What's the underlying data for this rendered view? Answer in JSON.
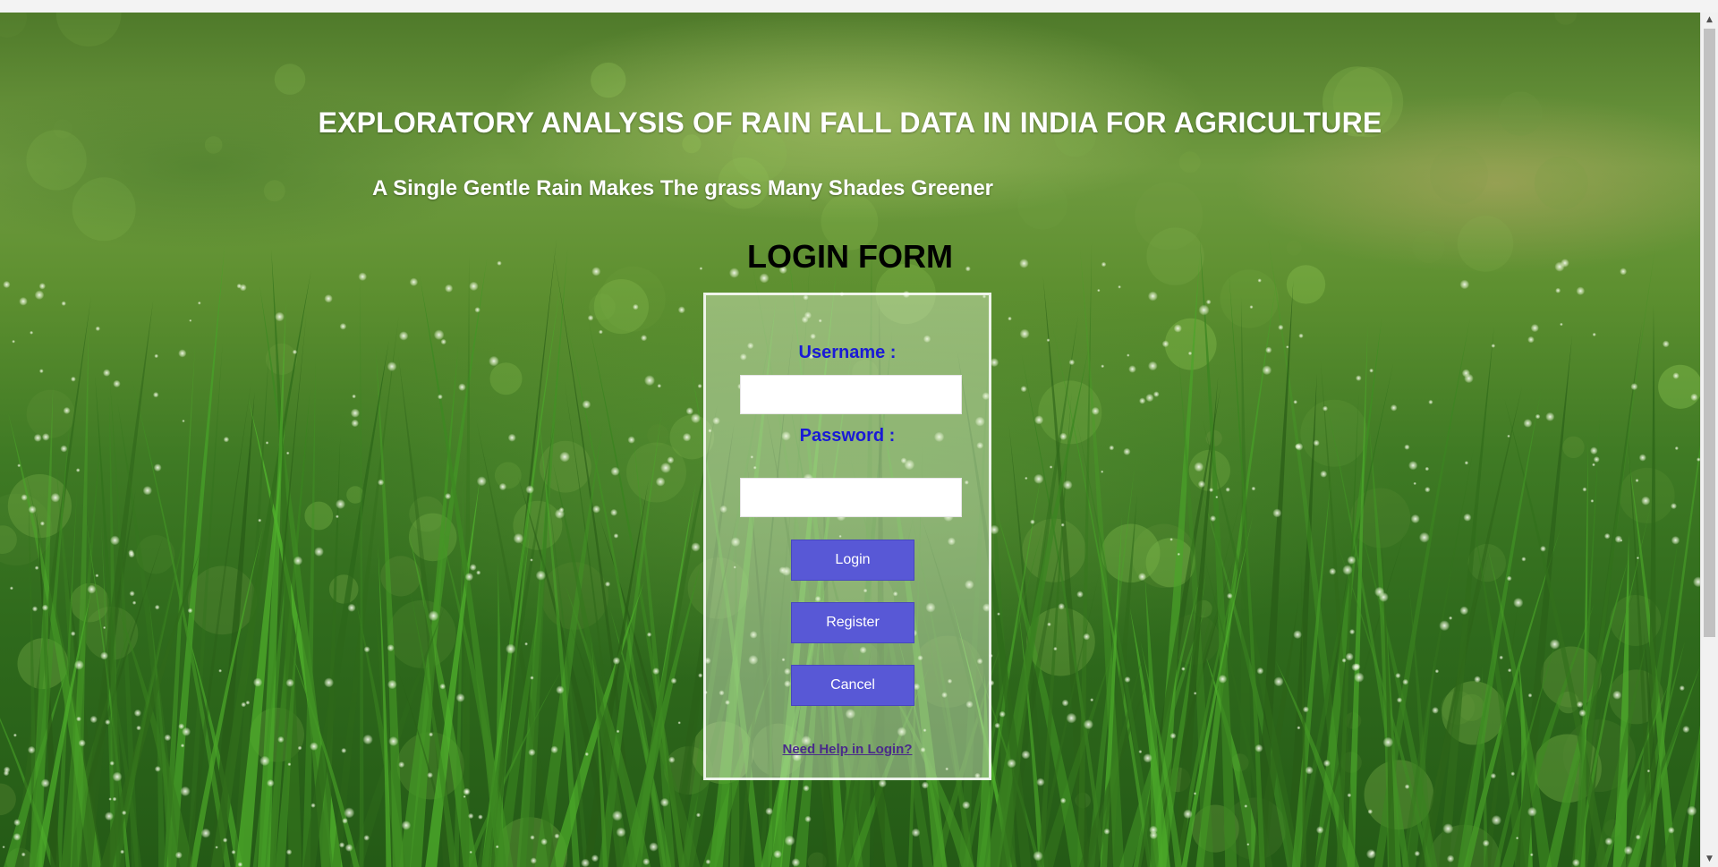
{
  "page": {
    "title": "EXPLORATORY ANALYSIS OF RAIN FALL DATA IN INDIA FOR AGRICULTURE",
    "tagline": "A Single Gentle Rain Makes The grass Many Shades Greener",
    "form_heading": "LOGIN FORM"
  },
  "form": {
    "username_label": "Username :",
    "password_label": "Password :",
    "username_value": "",
    "password_value": "",
    "login_label": "Login",
    "register_label": "Register",
    "cancel_label": "Cancel",
    "help_link": "Need Help in Login?"
  },
  "colors": {
    "label": "#1a1ad6",
    "button": "#5858d6",
    "link": "#4a2a8a"
  },
  "icons": {
    "scroll_up": "chevron-up-icon",
    "scroll_down": "chevron-down-icon"
  }
}
